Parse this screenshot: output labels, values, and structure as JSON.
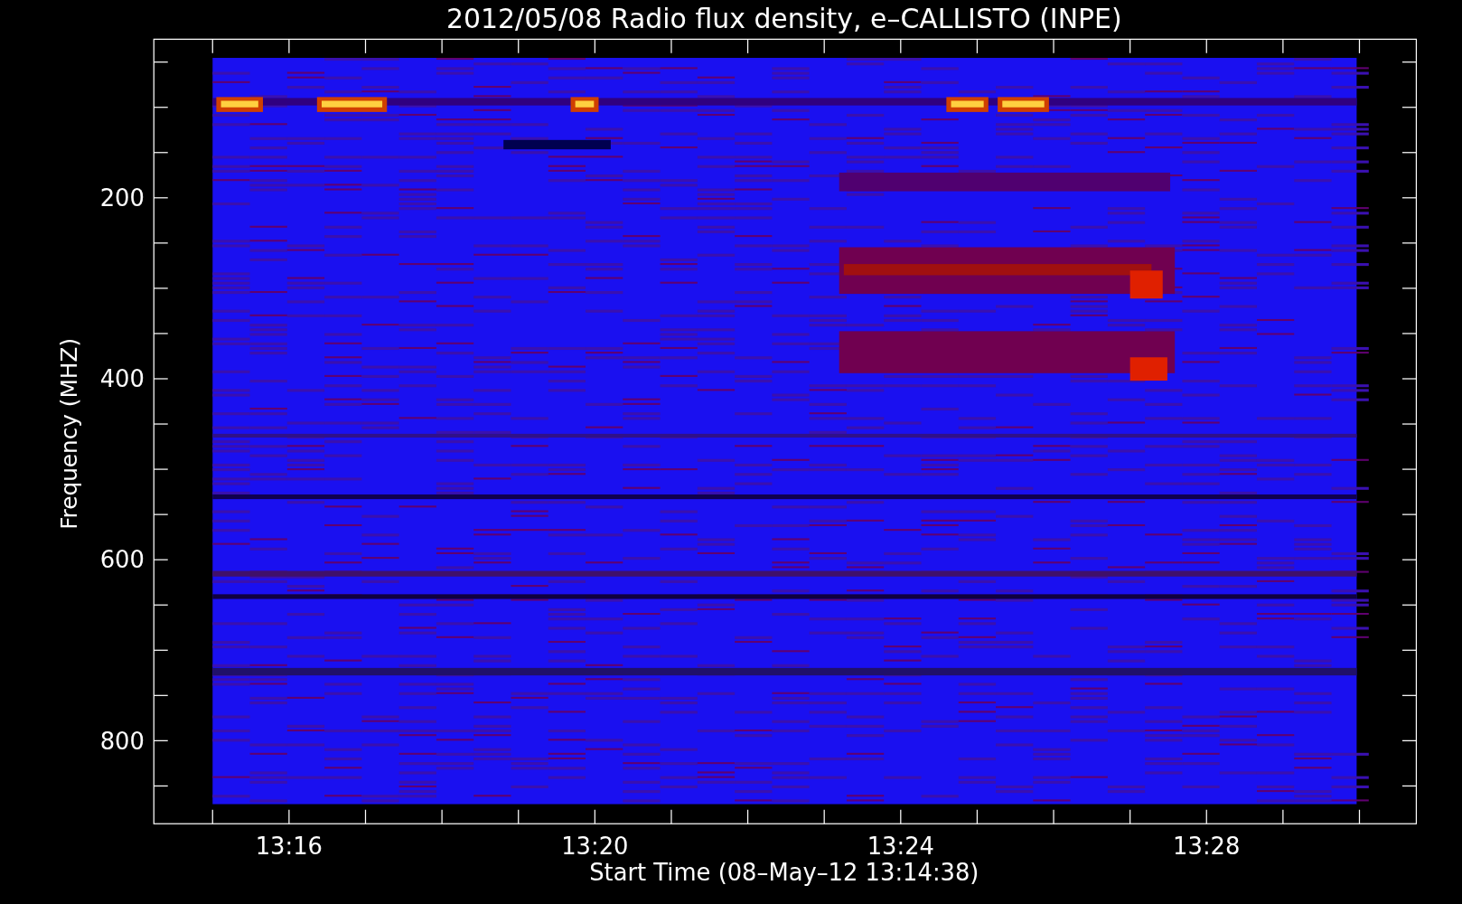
{
  "title": "2012/05/08  Radio flux density, e–CALLISTO (INPE)",
  "xlabel": "Start Time (08–May–12 13:14:38)",
  "ylabel": "Frequency (MHZ)",
  "x_tick_labels": [
    "13:16",
    "13:20",
    "13:24",
    "13:28"
  ],
  "y_tick_labels": [
    "200",
    "400",
    "600",
    "800"
  ]
}
